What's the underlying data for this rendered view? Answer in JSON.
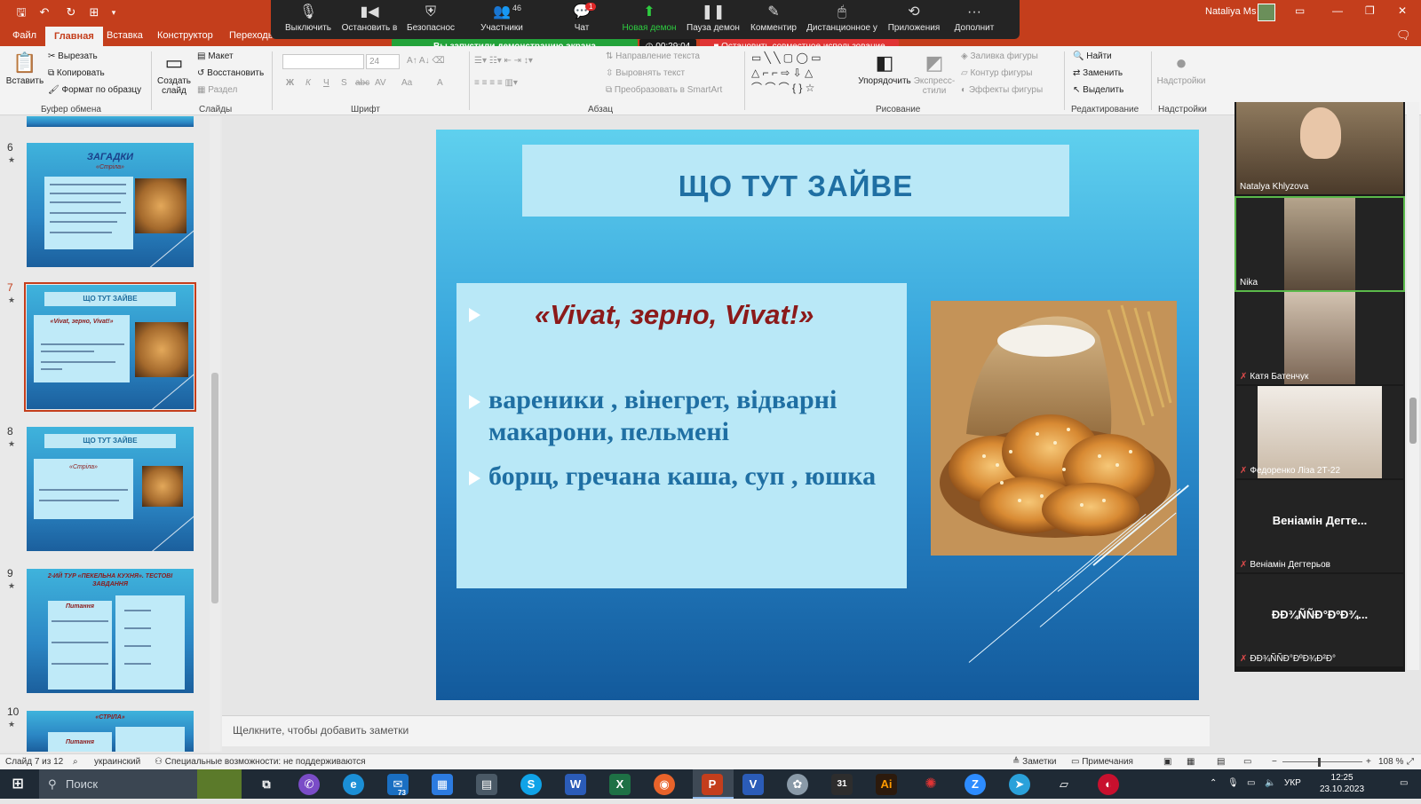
{
  "window": {
    "user_name": "Nataliya Ms",
    "controls": [
      "▭",
      "—",
      "❐",
      "✕"
    ]
  },
  "ribbon_tabs": [
    "Файл",
    "Главная",
    "Вставка",
    "Конструктор",
    "Переходы"
  ],
  "zoom": {
    "items": [
      {
        "label": "Выключить",
        "icon": "mic-icon"
      },
      {
        "label": "Остановить в",
        "icon": "video-icon"
      },
      {
        "label": "Безопаснос",
        "icon": "shield-icon"
      },
      {
        "label": "Участники",
        "icon": "participants-icon",
        "count": "46"
      },
      {
        "label": "Чат",
        "icon": "chat-icon",
        "badge": "1"
      },
      {
        "label": "Новая демон",
        "icon": "share-screen-icon"
      },
      {
        "label": "Пауза демон",
        "icon": "pause-icon"
      },
      {
        "label": "Комментир",
        "icon": "annotate-icon"
      },
      {
        "label": "Дистанционное у",
        "icon": "remote-control-icon"
      },
      {
        "label": "Приложения",
        "icon": "apps-icon"
      },
      {
        "label": "Дополнит",
        "icon": "more-icon"
      }
    ],
    "share_banner": "Вы запустили демонстрацию экрана",
    "share_timer": "00:29:04",
    "stop_share": "Остановить совместное использование"
  },
  "ribbon": {
    "clipboard": {
      "paste": "Вставить",
      "cut": "Вырезать",
      "copy": "Копировать",
      "format_painter": "Формат по образцу",
      "group": "Буфер обмена"
    },
    "slides": {
      "new_slide": "Создать слайд",
      "layout": "Макет",
      "reset": "Восстановить",
      "section": "Раздел",
      "group": "Слайды"
    },
    "font": {
      "size": "24",
      "group": "Шрифт",
      "buttons": [
        "Ж",
        "К",
        "Ч",
        "S",
        "abc",
        "AV",
        "Aa",
        "A"
      ]
    },
    "paragraph": {
      "text_direction": "Направление текста",
      "align_text": "Выровнять текст",
      "smartart": "Преобразовать в SmartArt",
      "group": "Абзац"
    },
    "drawing": {
      "arrange": "Упорядочить",
      "quick_styles": "Экспресс-стили",
      "shape_fill": "Заливка фигуры",
      "shape_outline": "Контур фигуры",
      "shape_effects": "Эффекты фигуры",
      "group": "Рисование"
    },
    "editing": {
      "find": "Найти",
      "replace": "Заменить",
      "select": "Выделить",
      "group": "Редактирование"
    },
    "addins": {
      "label": "Надстройки",
      "group": "Надстройки"
    }
  },
  "thumbnails": [
    {
      "num": "6",
      "title": "ЗАГАДКИ",
      "subtitle": "«Стріла»"
    },
    {
      "num": "7",
      "title": "ЩО ТУТ ЗАЙВЕ",
      "subtitle": "«Vivat, зерно, Vivat!»",
      "selected": true
    },
    {
      "num": "8",
      "title": "ЩО ТУТ ЗАЙВЕ",
      "subtitle": "«Стріла»"
    },
    {
      "num": "9",
      "title": "2-ИЙ ТУР «ПЕКЕЛЬНА КУХНЯ». ТЕСТОВІ ЗАВДАННЯ",
      "subtitle": "Питання"
    },
    {
      "num": "10",
      "title": "«СТРІЛА»",
      "subtitle": "Питання"
    }
  ],
  "slide": {
    "title": "ЩО  ТУТ ЗАЙВЕ",
    "subtitle": "«Vivat, зерно, Vivat!»",
    "bullets": [
      "вареники , вінегрет, відварні макарони, пельмені",
      "борщ, гречана каша, суп , юшка"
    ]
  },
  "notes_placeholder": "Щелкните, чтобы добавить заметки",
  "participants": [
    {
      "name": "Natalya Khlyzova",
      "video": true,
      "muted": false
    },
    {
      "name": "Nika",
      "video": true,
      "muted": false,
      "active": true
    },
    {
      "name": "Катя Батенчук",
      "video": true,
      "muted": true
    },
    {
      "name": "Федоренко Ліза 2Т-22",
      "video": true,
      "muted": true
    },
    {
      "name": "Веніамін Дегтерьов",
      "display": "Веніамін Дегте...",
      "video": false,
      "muted": true
    },
    {
      "name": "ÐÐ¾ÑÑÐ°ÐºÐ¾Ð²Ð°",
      "display": "ÐÐ¾ÑÑÐ°ÐºÐ¾...",
      "video": false,
      "muted": true
    }
  ],
  "status": {
    "slide": "Слайд 7 из 12",
    "language": "украинский",
    "accessibility": "Специальные возможности: не поддерживаются",
    "notes": "Заметки",
    "comments": "Примечания",
    "zoom": "108 %"
  },
  "taskbar": {
    "search": "Поиск",
    "apps": [
      "task-view",
      "viber",
      "edge",
      "mail",
      "calendar",
      "calculator",
      "skype",
      "word",
      "excel",
      "firefox",
      "powerpoint",
      "visio",
      "app",
      "calendar-31",
      "illustrator",
      "app-red",
      "zoom",
      "telegram",
      "app-doc",
      "app-red2"
    ],
    "mail_badge": "73",
    "calendar_label": "31",
    "language": "УКР",
    "time": "12:25",
    "date": "23.10.2023"
  }
}
